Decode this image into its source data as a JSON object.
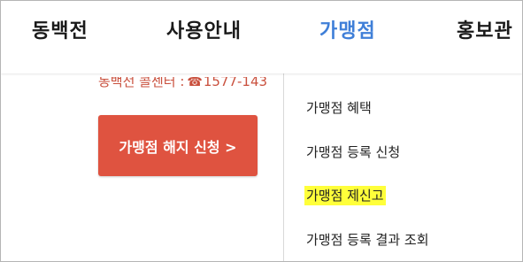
{
  "nav": {
    "items": [
      {
        "label": "동백전",
        "active": false
      },
      {
        "label": "사용안내",
        "active": false
      },
      {
        "label": "가맹점",
        "active": true
      },
      {
        "label": "홍보관",
        "active": false
      }
    ],
    "active_color": "#3f7fd8"
  },
  "content": {
    "callcenter_label": "동백전 콜센터 :",
    "callcenter_icon": "phone-icon",
    "callcenter_number": "1577-143",
    "cancel_button_label": "가맹점 해지 신청 >",
    "button_color": "#df5340"
  },
  "submenu": {
    "items": [
      {
        "label": "가맹점 혜택",
        "highlighted": false
      },
      {
        "label": "가맹점 등록 신청",
        "highlighted": false
      },
      {
        "label": "가맹점 제신고",
        "highlighted": true
      },
      {
        "label": "가맹점 등록 결과 조회",
        "highlighted": false
      }
    ],
    "highlight_color": "#ffff3a"
  }
}
